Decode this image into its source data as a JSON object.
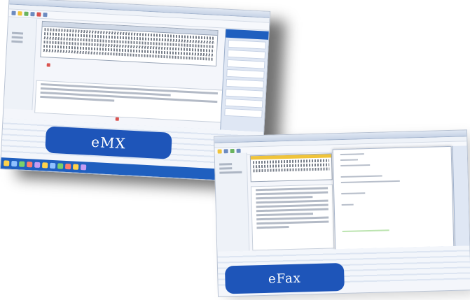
{
  "screens": [
    {
      "id": "main-window",
      "sidebar_header": "",
      "banner_text": "eMX",
      "sidebar_rows": [
        "",
        "",
        "",
        "",
        "",
        "",
        "",
        ""
      ],
      "link": ""
    },
    {
      "id": "dialog-window",
      "banner_text": "eFax",
      "dialog_labels": [
        "",
        "",
        ""
      ]
    }
  ],
  "colors": {
    "brand_blue": "#1e55b9",
    "sidebar_blue": "#1f5fbf",
    "accent_yellow": "#f0c43a"
  },
  "icons": [
    "toolbar-icons",
    "taskbar-tray-icons"
  ]
}
